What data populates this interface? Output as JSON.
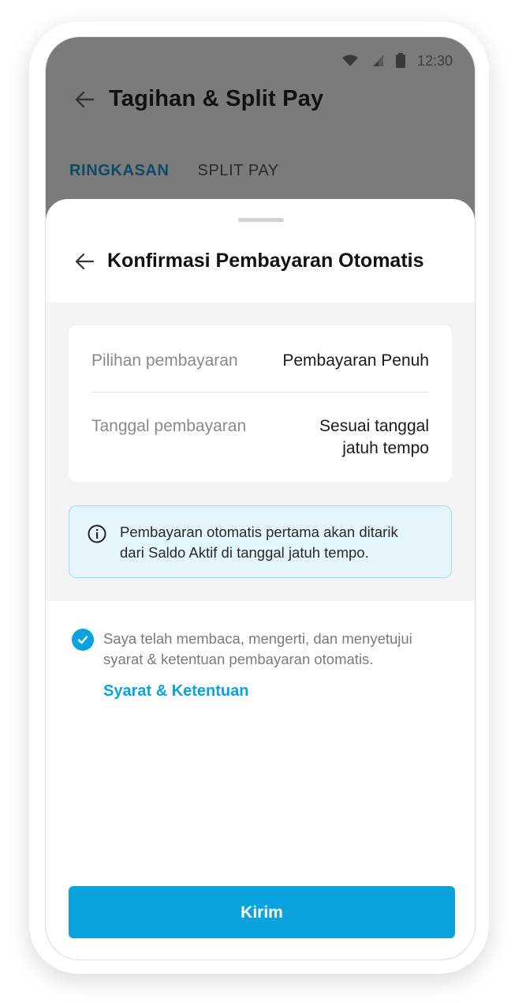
{
  "status_bar": {
    "time": "12:30"
  },
  "app": {
    "title": "Tagihan & Split Pay",
    "tabs": [
      {
        "label": "RINGKASAN",
        "active": true
      },
      {
        "label": "SPLIT PAY",
        "active": false
      }
    ]
  },
  "sheet": {
    "title": "Konfirmasi Pembayaran Otomatis",
    "details": [
      {
        "label": "Pilihan pembayaran",
        "value": "Pembayaran Penuh"
      },
      {
        "label": "Tanggal pembayaran",
        "value_line1": "Sesuai tanggal",
        "value_line2": "jatuh tempo"
      }
    ],
    "info_line1": "Pembayaran otomatis pertama akan ditarik",
    "info_line2": "dari Saldo Aktif di tanggal jatuh tempo.",
    "consent_line1": "Saya telah membaca, mengerti, dan menyetujui",
    "consent_line2": "syarat & ketentuan pembayaran otomatis.",
    "consent_checked": true,
    "terms_link": "Syarat & Ketentuan",
    "submit_label": "Kirim"
  },
  "colors": {
    "accent": "#0aa3dd",
    "active_tab": "#0d4a63",
    "info_bg": "#e4f5fc",
    "overlay": "#7b7b7b"
  },
  "icons": [
    "wifi-icon",
    "signal-icon",
    "battery-icon",
    "back-arrow-icon",
    "info-icon",
    "check-icon"
  ]
}
